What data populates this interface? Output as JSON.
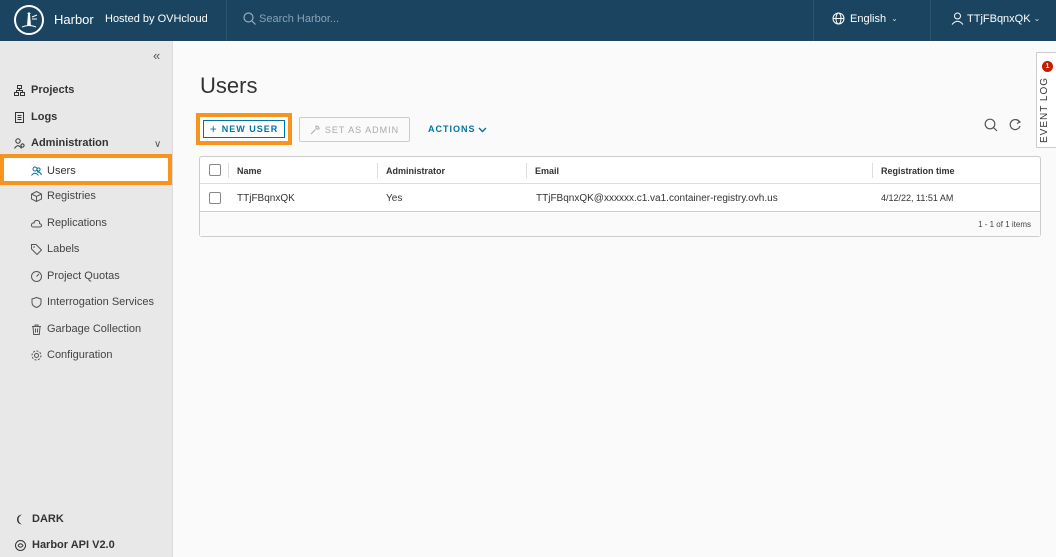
{
  "header": {
    "brand": "Harbor",
    "hosted": "Hosted by OVHcloud",
    "search_placeholder": "Search Harbor...",
    "language": "English",
    "username": "TTjFBqnxQK"
  },
  "sidebar": {
    "projects": "Projects",
    "logs": "Logs",
    "administration": "Administration",
    "items": [
      {
        "label": "Users",
        "icon": "users-icon"
      },
      {
        "label": "Registries",
        "icon": "cube-icon"
      },
      {
        "label": "Replications",
        "icon": "cloud-icon"
      },
      {
        "label": "Labels",
        "icon": "tag-icon"
      },
      {
        "label": "Project Quotas",
        "icon": "dashboard-icon"
      },
      {
        "label": "Interrogation Services",
        "icon": "shield-icon"
      },
      {
        "label": "Garbage Collection",
        "icon": "trash-icon"
      },
      {
        "label": "Configuration",
        "icon": "gear-icon"
      }
    ],
    "dark": "DARK",
    "api": "Harbor API V2.0"
  },
  "main": {
    "title": "Users",
    "new_user": "NEW USER",
    "set_admin": "SET AS ADMIN",
    "actions": "ACTIONS"
  },
  "table": {
    "columns": [
      "Name",
      "Administrator",
      "Email",
      "Registration time"
    ],
    "rows": [
      [
        "TTjFBqnxQK",
        "Yes",
        "TTjFBqnxQK@xxxxxx.c1.va1.container-registry.ovh.us",
        "4/12/22, 11:51 AM"
      ]
    ],
    "footer": "1 - 1 of 1 items"
  },
  "event_log": {
    "label": "EVENT LOG",
    "count": "1"
  },
  "colors": {
    "header": "#1a4460",
    "accent": "#0072a3",
    "highlight": "#f7941d"
  }
}
